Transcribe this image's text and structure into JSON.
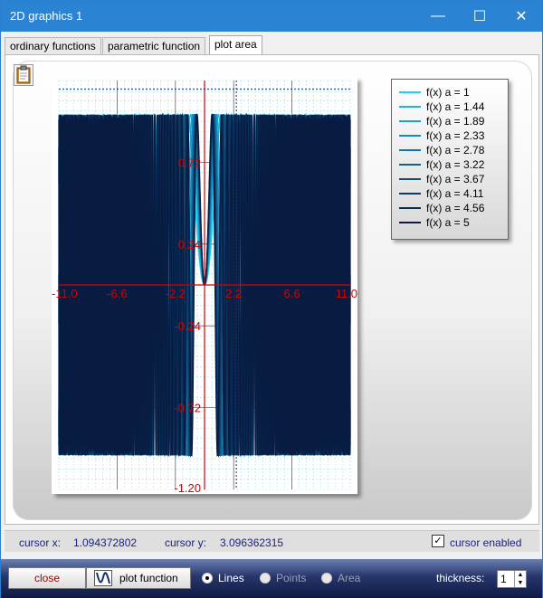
{
  "window": {
    "title": "2D graphics 1"
  },
  "titlebar_buttons": {
    "minimize": "—",
    "maximize": "☐",
    "close": "✕"
  },
  "tabs": [
    {
      "label": "ordinary functions"
    },
    {
      "label": "parametric function"
    },
    {
      "label": "plot area"
    }
  ],
  "active_tab": "plot area",
  "chart_data": {
    "type": "line",
    "function": "f(x) = sin(a·x^2)",
    "x_ticks": [
      "-11.0",
      "-6.6",
      "-2.2",
      "2.2",
      "6.6",
      "11.0"
    ],
    "y_ticks": [
      "0.72",
      "0.24",
      "-0.24",
      "-0.72",
      "-1.20"
    ],
    "xlim": [
      -11.0,
      11.0
    ],
    "ylim": [
      -1.2,
      1.2
    ],
    "grid": true,
    "legend_position": "right",
    "series": [
      {
        "name": "f(x) a = 1",
        "a": 1,
        "color": "#19d2f2"
      },
      {
        "name": "f(x) a = 1.44",
        "a": 1.44,
        "color": "#17b9e2"
      },
      {
        "name": "f(x) a = 1.89",
        "a": 1.89,
        "color": "#15a2d0"
      },
      {
        "name": "f(x) a = 2.33",
        "a": 2.33,
        "color": "#138cbd"
      },
      {
        "name": "f(x) a = 2.78",
        "a": 2.78,
        "color": "#1277a8"
      },
      {
        "name": "f(x) a = 3.22",
        "a": 3.22,
        "color": "#106292"
      },
      {
        "name": "f(x) a = 3.67",
        "a": 3.67,
        "color": "#0e4e7c"
      },
      {
        "name": "f(x) a = 4.11",
        "a": 4.11,
        "color": "#0c3b67"
      },
      {
        "name": "f(x) a = 4.56",
        "a": 4.56,
        "color": "#0a2a54"
      },
      {
        "name": "f(x) a = 5",
        "a": 5,
        "color": "#081c42"
      }
    ],
    "cursor_line_x": 2.4,
    "cursor_line_y": 1.15
  },
  "status": {
    "cursor_x_label": "cursor x:",
    "cursor_x_value": "1.094372802",
    "cursor_y_label": "cursor y:",
    "cursor_y_value": "3.096362315",
    "cursor_enabled_label": "cursor enabled",
    "cursor_enabled": true
  },
  "toolbar": {
    "close_label": "close",
    "plot_label": "plot function",
    "radio_lines": "Lines",
    "radio_points": "Points",
    "radio_area": "Area",
    "thickness_label": "thickness:",
    "thickness_value": "1"
  }
}
